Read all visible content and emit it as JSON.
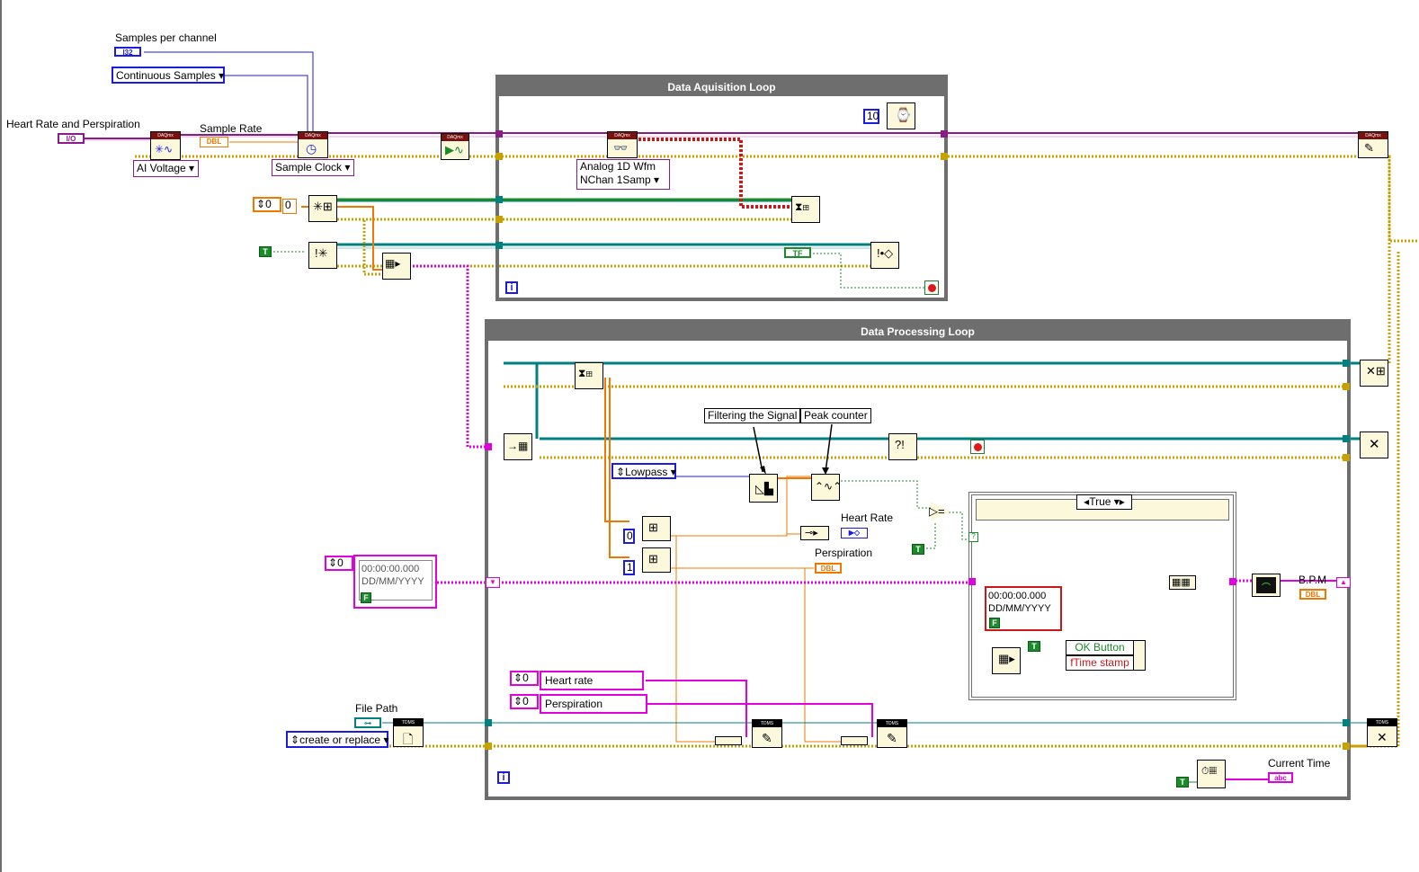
{
  "labels": {
    "samples_per_channel": "Samples per channel",
    "heart_rate_and_perspiration": "Heart Rate and Perspiration",
    "sample_rate": "Sample Rate",
    "heart_rate": "Heart Rate",
    "perspiration": "Perspiration",
    "bpm": "B.P.M",
    "file_path": "File Path",
    "current_time": "Current Time",
    "filtering_the_signal": "Filtering the Signal",
    "peak_counter": "Peak counter"
  },
  "loops": {
    "acquisition_title": "Data Aquisition Loop",
    "processing_title": "Data Processing Loop",
    "iteration_glyph": "i"
  },
  "controls": {
    "continuous_samples": "Continuous Samples",
    "ai_voltage": "AI Voltage",
    "sample_clock": "Sample Clock",
    "analog_wfm_line1": "Analog 1D Wfm",
    "analog_wfm_line2": "NChan 1Samp",
    "lowpass": "Lowpass",
    "create_or_replace": "create or replace",
    "case_selector": "True",
    "ok_button": "OK Button",
    "time_stamp": "fTime stamp",
    "heart_rate_string": "Heart rate",
    "perspiration_string": "Perspiration",
    "wait_ms": "10",
    "index_0": "0",
    "index_1": "1",
    "queue_size_a": "0",
    "queue_size_b": "0",
    "array_index_a": "0",
    "array_index_b": "0",
    "array_index_c": "0",
    "timestamp_time": "00:00:00.000",
    "timestamp_date": "DD/MM/YYYY"
  },
  "type_tags": {
    "i32": "I32",
    "io": "I/O",
    "dbl": "DBL",
    "tf": "TF",
    "abc": "abc",
    "tdms": "TDMS",
    "daqmx": "DAQmx",
    "true_const": "T",
    "false_const": "F"
  },
  "colors": {
    "loop_border": "#6e6e6e",
    "int_wire": "#1c1ce0",
    "dbl_wire": "#f07800",
    "bool_wire": "#1b8a2b",
    "string_wire": "#e000e0",
    "error_wire": "#c8a000",
    "refnum_wire": "#008080",
    "daq_wire": "#8b1a8b",
    "node_fill": "#fbf8dc"
  }
}
